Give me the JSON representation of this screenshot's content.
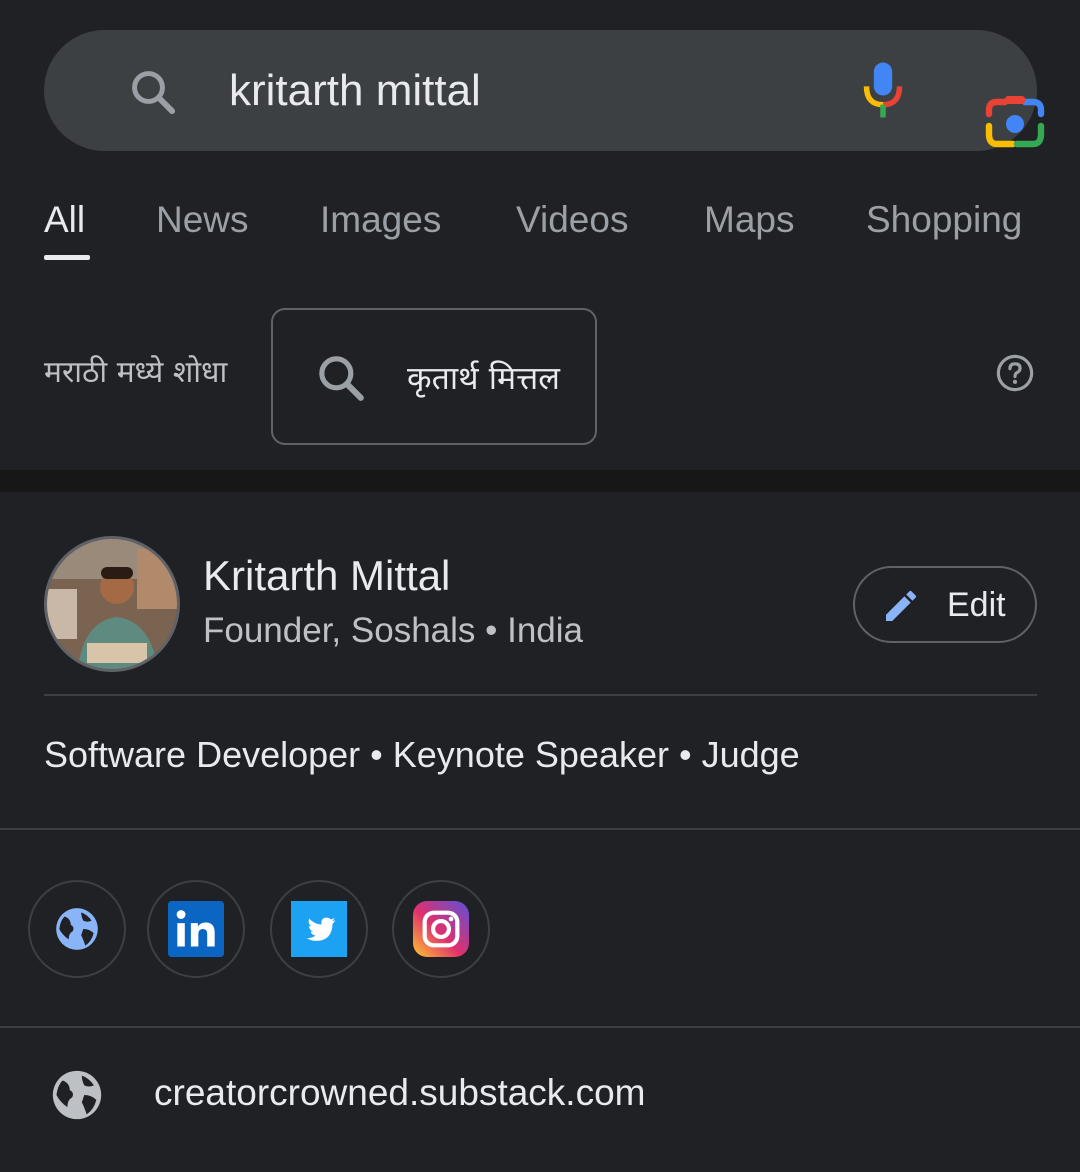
{
  "search": {
    "query": "kritarth mittal"
  },
  "tabs": [
    {
      "label": "All",
      "active": true
    },
    {
      "label": "News"
    },
    {
      "label": "Images"
    },
    {
      "label": "Videos"
    },
    {
      "label": "Maps"
    },
    {
      "label": "Shopping"
    }
  ],
  "transliteration": {
    "label": "मराठी मध्ये शोधा",
    "suggestion": "कृतार्थ मित्तल"
  },
  "profile": {
    "name": "Kritarth Mittal",
    "subtitle": "Founder, Soshals • India",
    "edit_label": "Edit",
    "tagline": "Software Developer • Keynote Speaker • Judge",
    "social_links": [
      {
        "icon": "globe-icon"
      },
      {
        "icon": "linkedin-icon"
      },
      {
        "icon": "twitter-icon"
      },
      {
        "icon": "instagram-icon"
      }
    ],
    "website": "creatorcrowned.substack.com"
  },
  "colors": {
    "background": "#202124",
    "searchbar": "#3c4043",
    "accent_blue": "#8ab4f8"
  }
}
